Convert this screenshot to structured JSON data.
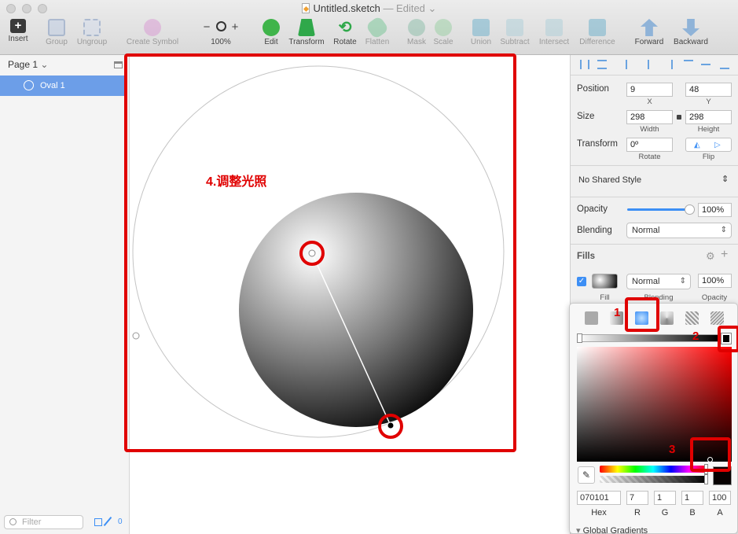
{
  "window": {
    "title": "Untitled.sketch",
    "status": "— Edited"
  },
  "toolbar": [
    {
      "label": "Insert",
      "icon": "plus-icon",
      "enabled": true
    },
    {
      "label": "Group",
      "icon": "group-icon",
      "enabled": false
    },
    {
      "label": "Ungroup",
      "icon": "ungroup-icon",
      "enabled": false
    },
    {
      "label": "Create Symbol",
      "icon": "symbol-icon",
      "enabled": false
    },
    {
      "label": "100%",
      "icon": "zoom-icon",
      "enabled": true
    },
    {
      "label": "Edit",
      "icon": "edit-icon",
      "enabled": true
    },
    {
      "label": "Transform",
      "icon": "transform-icon",
      "enabled": true
    },
    {
      "label": "Rotate",
      "icon": "rotate-icon",
      "enabled": true
    },
    {
      "label": "Flatten",
      "icon": "flatten-icon",
      "enabled": false
    },
    {
      "label": "Mask",
      "icon": "mask-icon",
      "enabled": false
    },
    {
      "label": "Scale",
      "icon": "scale-icon",
      "enabled": false
    },
    {
      "label": "Union",
      "icon": "union-icon",
      "enabled": false
    },
    {
      "label": "Subtract",
      "icon": "subtract-icon",
      "enabled": false
    },
    {
      "label": "Intersect",
      "icon": "intersect-icon",
      "enabled": false
    },
    {
      "label": "Difference",
      "icon": "difference-icon",
      "enabled": false
    },
    {
      "label": "Forward",
      "icon": "forward-icon",
      "enabled": true
    },
    {
      "label": "Backward",
      "icon": "backward-icon",
      "enabled": true
    }
  ],
  "zoom": {
    "minus": "−",
    "plus": "+"
  },
  "sidebar": {
    "page": "Page 1",
    "layers": [
      {
        "name": "Oval 1",
        "selected": true
      }
    ],
    "filter_placeholder": "Filter",
    "count": "0"
  },
  "canvas": {
    "annotation": "4.调整光照",
    "gradient": {
      "from": "#ffffff",
      "to": "#000000",
      "type": "radial"
    }
  },
  "inspector": {
    "position_label": "Position",
    "x": "9",
    "x_label": "X",
    "y": "48",
    "y_label": "Y",
    "size_label": "Size",
    "width": "298",
    "width_label": "Width",
    "height": "298",
    "height_label": "Height",
    "transform_label": "Transform",
    "rotate": "0º",
    "rotate_label": "Rotate",
    "flip_label": "Flip",
    "shared_style": "No Shared Style",
    "opacity_label": "Opacity",
    "opacity_value": "100%",
    "opacity_level": 1.0,
    "blending_label": "Blending",
    "blending_value": "Normal",
    "fills_label": "Fills",
    "fill": {
      "enabled": true,
      "mode": "Normal",
      "opacity": "100%",
      "fill_label": "Fill",
      "blending_label": "Blending",
      "opacity_label": "Opacity"
    }
  },
  "color_popup": {
    "fill_types": [
      "solid",
      "linear-gradient",
      "radial-gradient",
      "angular-gradient",
      "pattern",
      "noise"
    ],
    "selected_fill_type": "radial-gradient",
    "hex": "070101",
    "hex_label": "Hex",
    "r": "7",
    "r_label": "R",
    "g": "1",
    "g_label": "G",
    "b": "1",
    "b_label": "B",
    "a": "100",
    "a_label": "A",
    "global_gradients": "Global Gradients"
  },
  "callouts": [
    "1",
    "2",
    "3"
  ],
  "colors": {
    "selection": "#6c9ee8",
    "annotation_red": "#e00000",
    "accent_blue": "#3d8ff5"
  }
}
